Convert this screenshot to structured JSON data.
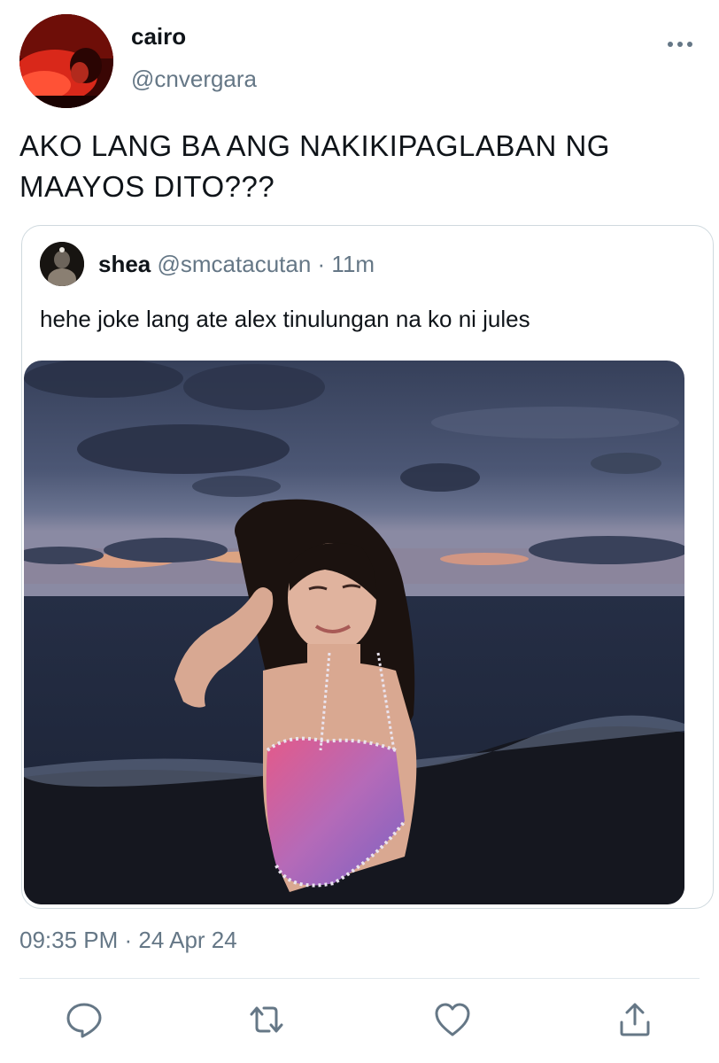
{
  "tweet": {
    "author_name": "cairo",
    "author_handle": "@cnvergara",
    "text": "AKO LANG BA ANG NAKIKIPAGLABAN NG MAAYOS DITO???",
    "timestamp": "09:35 PM · 24 Apr 24",
    "more_icon": "ellipsis-icon"
  },
  "quoted": {
    "author_name": "shea",
    "author_handle": "@smcatacutan",
    "separator": " · ",
    "time": "11m",
    "text": "hehe joke lang ate alex tinulungan na ko ni jules"
  },
  "actions": [
    {
      "icon": "reply-icon"
    },
    {
      "icon": "retweet-icon"
    },
    {
      "icon": "like-icon"
    },
    {
      "icon": "share-icon"
    }
  ],
  "colors": {
    "text": "#0f1419",
    "secondary": "#657786",
    "border": "#cfd9de"
  }
}
